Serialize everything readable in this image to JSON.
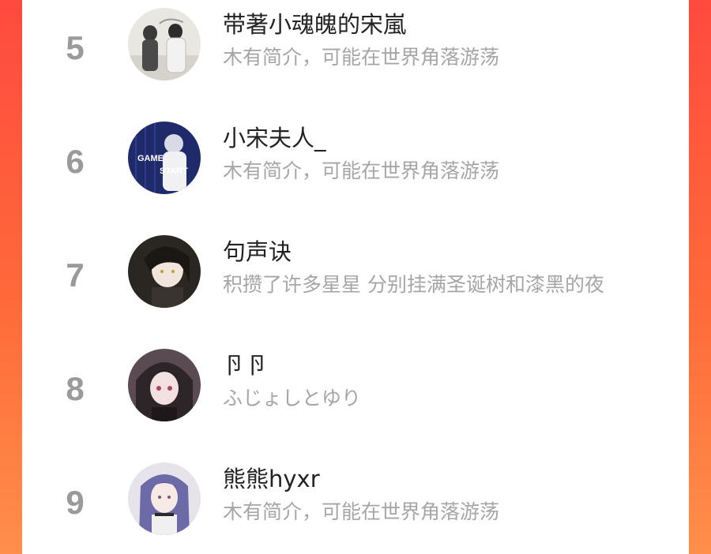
{
  "leaderboard": {
    "entries": [
      {
        "rank": "5",
        "name": "带著小魂魄的宋嵐",
        "bio": "木有简介，可能在世界角落游荡"
      },
      {
        "rank": "6",
        "name": "小宋夫人_",
        "bio": "木有简介，可能在世界角落游荡",
        "avatar_text": [
          "GAME",
          "START"
        ]
      },
      {
        "rank": "7",
        "name": "句声诀",
        "bio": "积攒了许多星星 分别挂满圣诞树和漆黑的夜"
      },
      {
        "rank": "8",
        "name": "卪卪",
        "bio": "ふじょしとゆり"
      },
      {
        "rank": "9",
        "name": "熊熊hyxr",
        "bio": "木有简介，可能在世界角落游荡"
      }
    ]
  },
  "colors": {
    "background_gradient_top": "#ff4a3f",
    "background_gradient_bottom": "#ff8f4a",
    "panel": "#ffffff",
    "rank_text": "#9a9a9a",
    "name_text": "#222222",
    "bio_text": "#a6a6a6"
  }
}
